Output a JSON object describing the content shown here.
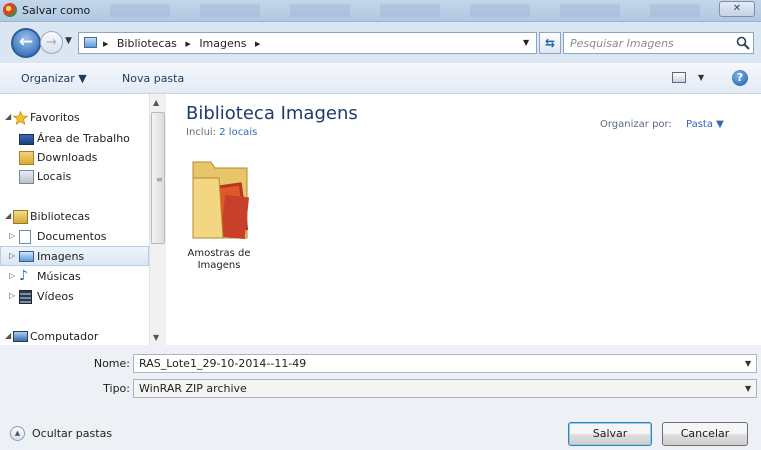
{
  "window": {
    "title": "Salvar como",
    "close_icon": "close-icon"
  },
  "address": {
    "crumbs": [
      "Bibliotecas",
      "Imagens"
    ],
    "search_placeholder": "Pesquisar Imagens"
  },
  "toolbar": {
    "organize_label": "Organizar ▼",
    "new_folder_label": "Nova pasta"
  },
  "nav": {
    "favorites": "Favoritos",
    "desktop": "Área de Trabalho",
    "downloads": "Downloads",
    "locais": "Locais",
    "libraries": "Bibliotecas",
    "documents": "Documentos",
    "images": "Imagens",
    "music": "Músicas",
    "videos": "Vídeos",
    "computer": "Computador"
  },
  "content": {
    "library_title": "Biblioteca Imagens",
    "includes_prefix": "Inclui:",
    "includes_link": "2 locais",
    "sort_label": "Organizar por:",
    "sort_value": "Pasta ▼",
    "folder_name": "Amostras de Imagens"
  },
  "form": {
    "name_label": "Nome:",
    "name_value": "RAS_Lote1_29-10-2014--11-49",
    "type_label": "Tipo:",
    "type_value": "WinRAR ZIP archive"
  },
  "footer": {
    "hide_folders_label": "Ocultar pastas",
    "save_label": "Salvar",
    "cancel_label": "Cancelar"
  },
  "colors": {
    "accent": "#1e3a6e",
    "link": "#2f69b6",
    "selection": "#dbe7f4"
  }
}
